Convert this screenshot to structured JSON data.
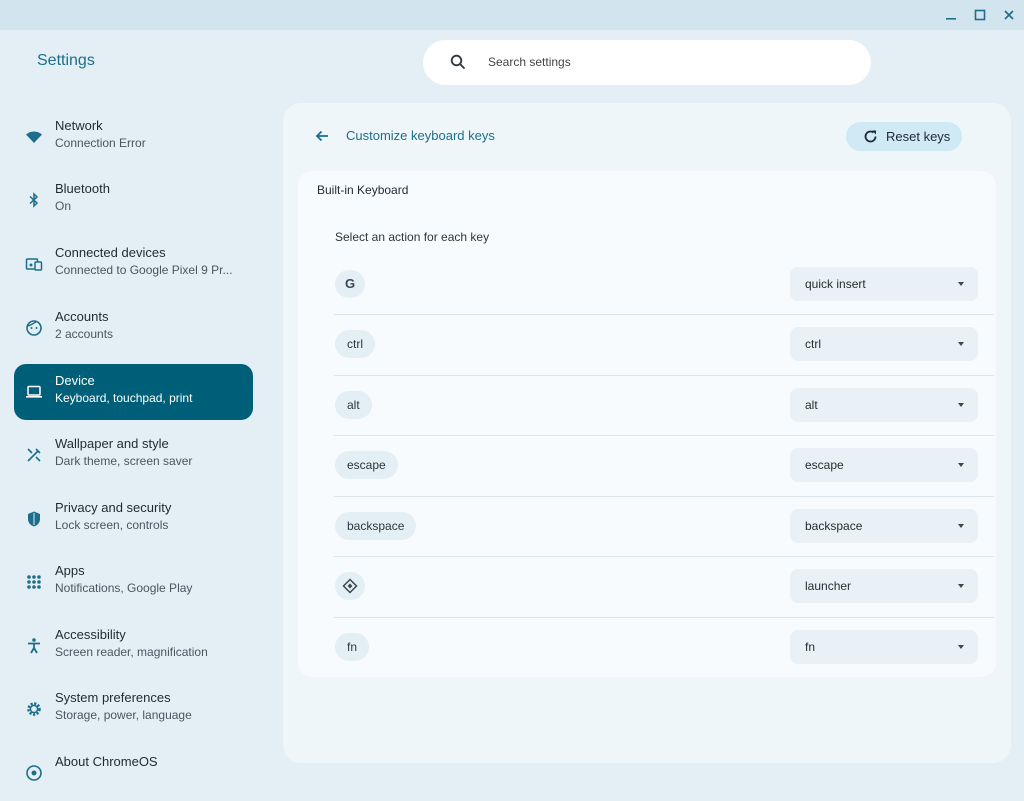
{
  "app": {
    "title": "Settings"
  },
  "search": {
    "placeholder": "Search settings"
  },
  "sidebar": {
    "items": [
      {
        "label": "Network",
        "sub": "Connection Error",
        "icon": "wifi-icon"
      },
      {
        "label": "Bluetooth",
        "sub": "On",
        "icon": "bluetooth-icon"
      },
      {
        "label": "Connected devices",
        "sub": "Connected to Google Pixel 9 Pr...",
        "icon": "connected-devices-icon"
      },
      {
        "label": "Accounts",
        "sub": "2 accounts",
        "icon": "accounts-icon"
      },
      {
        "label": "Device",
        "sub": "Keyboard, touchpad, print",
        "icon": "laptop-icon",
        "active": true
      },
      {
        "label": "Wallpaper and style",
        "sub": "Dark theme, screen saver",
        "icon": "wallpaper-icon"
      },
      {
        "label": "Privacy and security",
        "sub": "Lock screen, controls",
        "icon": "shield-icon"
      },
      {
        "label": "Apps",
        "sub": "Notifications, Google Play",
        "icon": "apps-grid-icon"
      },
      {
        "label": "Accessibility",
        "sub": "Screen reader, magnification",
        "icon": "accessibility-icon"
      },
      {
        "label": "System preferences",
        "sub": "Storage, power, language",
        "icon": "gear-icon"
      },
      {
        "label": "About ChromeOS",
        "sub": "",
        "icon": "chromeos-icon"
      }
    ]
  },
  "page": {
    "heading": "Customize keyboard keys",
    "reset_label": "Reset keys",
    "card_title": "Built-in Keyboard",
    "card_subtitle": "Select an action for each key",
    "keys": [
      {
        "key": "G",
        "action": "quick insert"
      },
      {
        "key": "ctrl",
        "action": "ctrl"
      },
      {
        "key": "alt",
        "action": "alt"
      },
      {
        "key": "escape",
        "action": "escape"
      },
      {
        "key": "backspace",
        "action": "backspace"
      },
      {
        "key": "",
        "action": "launcher"
      },
      {
        "key": "fn",
        "action": "fn"
      }
    ]
  },
  "colors": {
    "accent": "#1d6e8a",
    "active_bg": "#005f78",
    "background": "#e3eef5"
  }
}
